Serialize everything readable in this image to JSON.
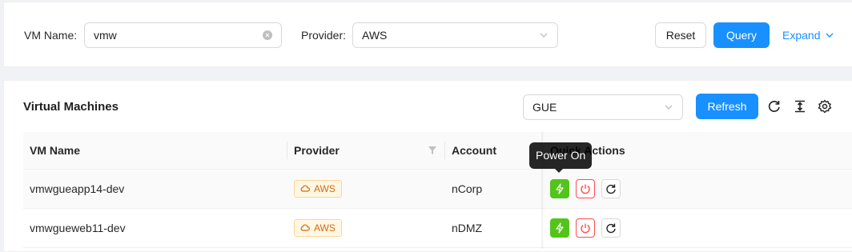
{
  "search": {
    "vm_name_label": "VM Name:",
    "vm_name_value": "vmw",
    "provider_label": "Provider:",
    "provider_value": "AWS",
    "reset_label": "Reset",
    "query_label": "Query",
    "expand_label": "Expand"
  },
  "table_card": {
    "title": "Virtual Machines",
    "filter_value": "GUE",
    "refresh_label": "Refresh",
    "columns": [
      "VM Name",
      "Provider",
      "Account",
      "Quick Actions"
    ],
    "rows": [
      {
        "vm_name": "vmwgueapp14-dev",
        "provider": "AWS",
        "account": "nCorp"
      },
      {
        "vm_name": "vmwgueweb11-dev",
        "provider": "AWS",
        "account": "nDMZ"
      }
    ]
  },
  "tooltip": {
    "text": "Power On"
  },
  "colors": {
    "primary": "#1890ff",
    "power_on": "#52c41a",
    "power_off": "#ff4d4f",
    "tag_text": "#d46b08"
  },
  "icons": [
    "clear-icon",
    "chevron-down-icon",
    "reload-icon",
    "column-height-icon",
    "setting-icon",
    "filter-icon",
    "cloud-icon",
    "thunderbolt-icon",
    "poweroff-icon",
    "redo-icon"
  ]
}
